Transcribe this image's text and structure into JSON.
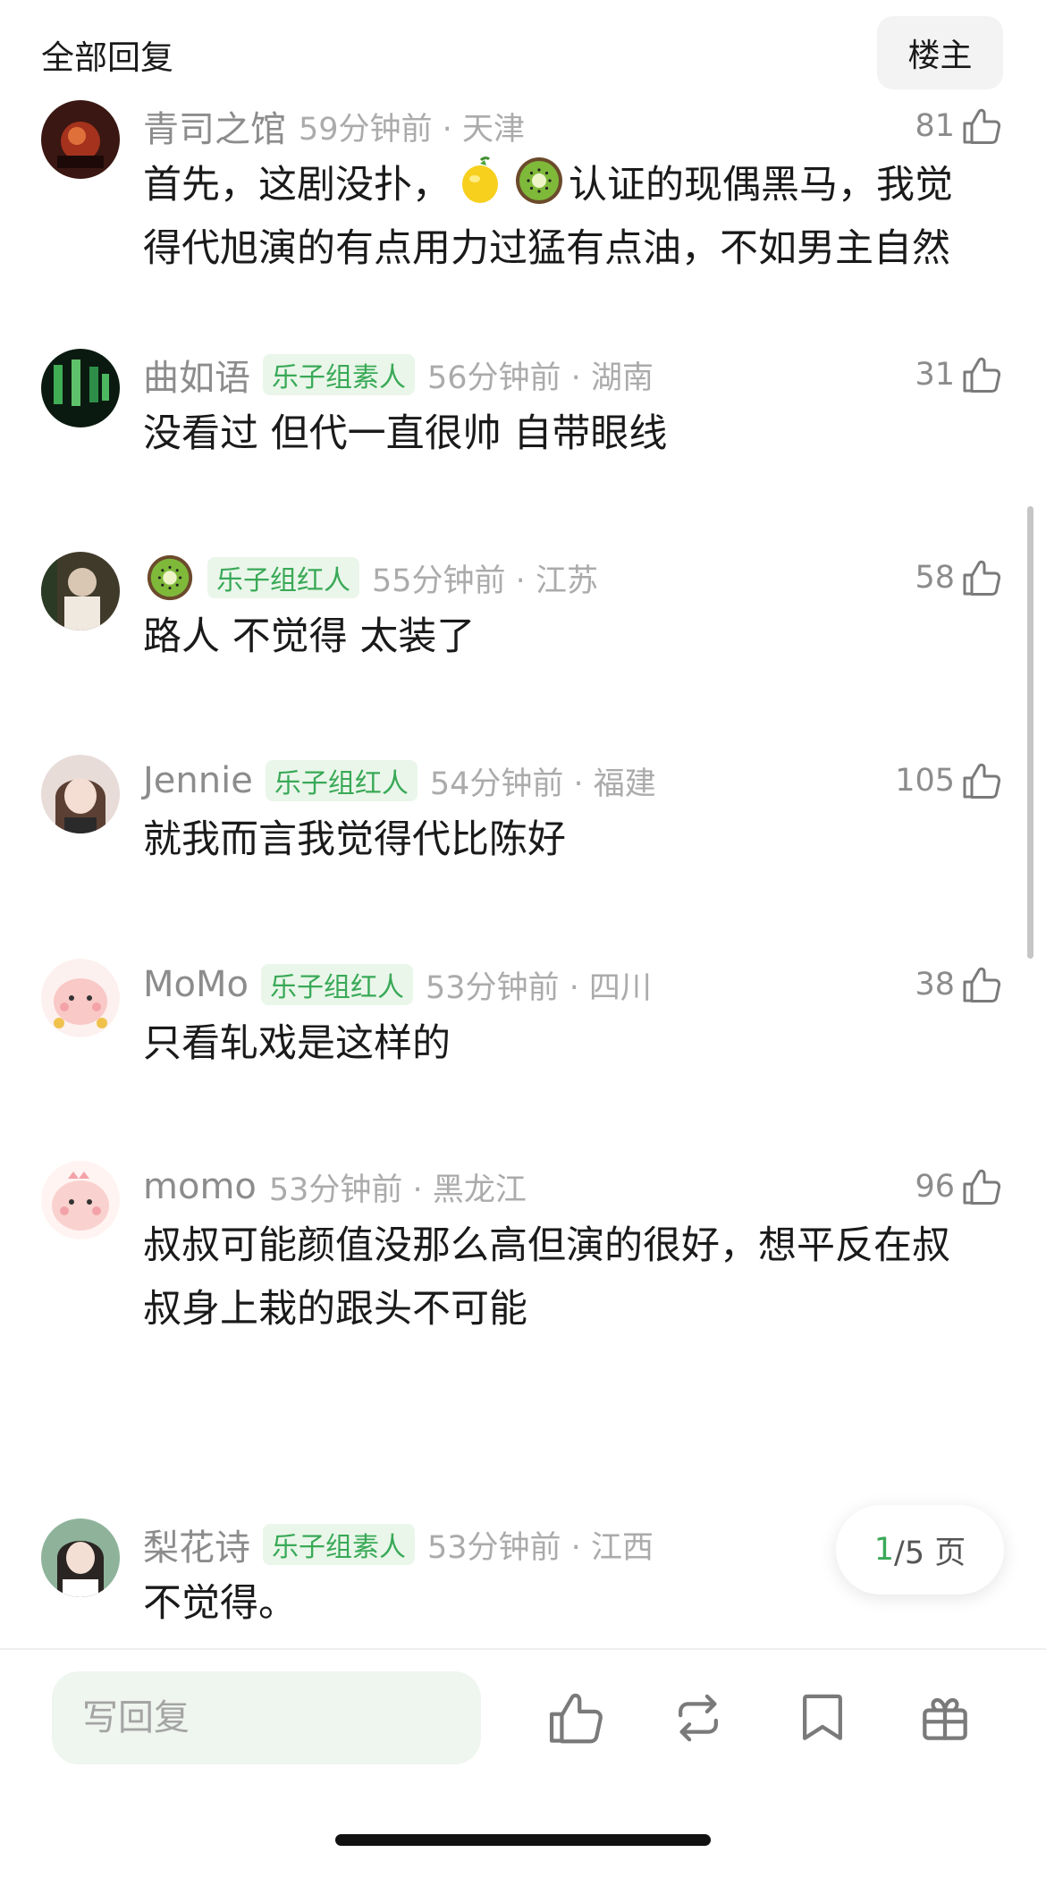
{
  "header": {
    "title": "全部回复",
    "op_filter_label": "楼主"
  },
  "colors": {
    "accent_green": "#39a957",
    "badge_bg": "#eaf6ea",
    "muted_text": "#8c8c8c",
    "meta_text": "#ababab"
  },
  "comments": [
    {
      "username": "青司之馆",
      "badge": "",
      "time": "59分钟前",
      "location": "天津",
      "likes": "81",
      "text_parts": [
        "首先，这剧没扑，",
        "认证的现偶黑马，我觉得代旭演的有点用力过猛有点油，不如男主自然"
      ],
      "inline_emojis": [
        "lemon-emoji",
        "kiwi-emoji"
      ]
    },
    {
      "username": "曲如语",
      "badge": "乐子组素人",
      "time": "56分钟前",
      "location": "湖南",
      "likes": "31",
      "text": "没看过 但代一直很帅 自带眼线"
    },
    {
      "username": "",
      "username_emoji": "kiwi-emoji",
      "badge": "乐子组红人",
      "time": "55分钟前",
      "location": "江苏",
      "likes": "58",
      "text": "路人 不觉得 太装了"
    },
    {
      "username": "Jennie",
      "badge": "乐子组红人",
      "time": "54分钟前",
      "location": "福建",
      "likes": "105",
      "text": "就我而言我觉得代比陈好"
    },
    {
      "username": "MoMo",
      "badge": "乐子组红人",
      "time": "53分钟前",
      "location": "四川",
      "likes": "38",
      "text": "只看轧戏是这样的"
    },
    {
      "username": "momo",
      "badge": "",
      "time": "53分钟前",
      "location": "黑龙江",
      "likes": "96",
      "text": "叔叔可能颜值没那么高但演的很好，想平反在叔叔身上栽的跟头不可能"
    },
    {
      "username": "梨花诗",
      "badge": "乐子组素人",
      "time": "53分钟前",
      "location": "江西",
      "likes": "",
      "text": "不觉得。"
    }
  ],
  "pager": {
    "current": "1",
    "total_text": "/5 页"
  },
  "bottom_bar": {
    "reply_placeholder": "写回复",
    "icons": [
      "thumb-up-icon",
      "repost-icon",
      "bookmark-icon",
      "gift-icon"
    ]
  }
}
